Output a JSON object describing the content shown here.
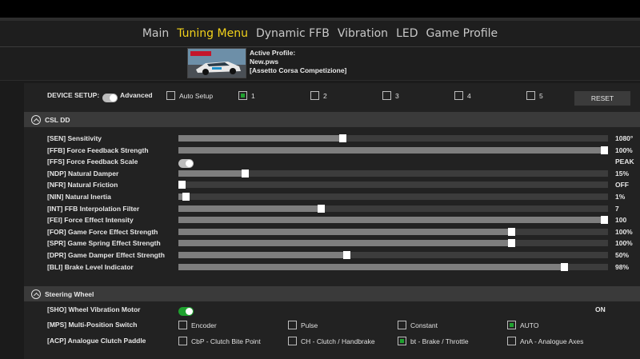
{
  "nav": {
    "tabs": [
      {
        "label": "Main",
        "active": false
      },
      {
        "label": "Tuning Menu",
        "active": true
      },
      {
        "label": "Dynamic FFB",
        "active": false
      },
      {
        "label": "Vibration",
        "active": false
      },
      {
        "label": "LED",
        "active": false
      },
      {
        "label": "Game Profile",
        "active": false
      }
    ]
  },
  "profile": {
    "line1": "Active Profile:",
    "line2": "New.pws",
    "line3": "[Assetto Corsa Competizione]",
    "thumbnail_icon": "race-car-thumbnail"
  },
  "device_setup": {
    "label": "DEVICE SETUP:",
    "advanced_label": "Advanced",
    "auto_setup_label": "Auto Setup",
    "slots": [
      {
        "label": "1",
        "checked": true
      },
      {
        "label": "2",
        "checked": false
      },
      {
        "label": "3",
        "checked": false
      },
      {
        "label": "4",
        "checked": false
      },
      {
        "label": "5",
        "checked": false
      }
    ],
    "reset_label": "RESET"
  },
  "csl_dd": {
    "title": "CSL DD",
    "params": [
      {
        "label": "[SEN] Sensitivity",
        "value": "1080°",
        "level": 0.38
      },
      {
        "label": "[FFB] Force Feedback Strength",
        "value": "100%",
        "level": 1.0
      },
      {
        "label": "[FFS] Force Feedback Scale",
        "value": "PEAK",
        "toggle": true
      },
      {
        "label": "[NDP] Natural Damper",
        "value": "15%",
        "level": 0.15
      },
      {
        "label": "[NFR] Natural Friction",
        "value": "OFF",
        "level": 0.0
      },
      {
        "label": "[NIN] Natural Inertia",
        "value": "1%",
        "level": 0.01
      },
      {
        "label": "[INT] FFB Interpolation Filter",
        "value": "7",
        "level": 0.33
      },
      {
        "label": "[FEI] Force Effect Intensity",
        "value": "100",
        "level": 1.0
      },
      {
        "label": "[FOR] Game Force Effect Strength",
        "value": "100%",
        "level": 0.78
      },
      {
        "label": "[SPR] Game Spring Effect Strength",
        "value": "100%",
        "level": 0.78
      },
      {
        "label": "[DPR] Game Damper Effect Strength",
        "value": "50%",
        "level": 0.39
      },
      {
        "label": "[BLI] Brake Level Indicator",
        "value": "98%",
        "level": 0.905
      }
    ]
  },
  "steering_wheel": {
    "title": "Steering Wheel",
    "sho": {
      "label": "[SHO] Wheel Vibration Motor",
      "value": "ON"
    },
    "mps": {
      "label": "[MPS] Multi-Position Switch",
      "options": [
        {
          "label": "Encoder",
          "checked": false
        },
        {
          "label": "Pulse",
          "checked": false
        },
        {
          "label": "Constant",
          "checked": false
        },
        {
          "label": "AUTO",
          "checked": true
        }
      ]
    },
    "acp": {
      "label": "[ACP] Analogue Clutch Paddle",
      "options": [
        {
          "label": "CbP - Clutch Bite Point",
          "checked": false
        },
        {
          "label": "CH - Clutch / Handbrake",
          "checked": false
        },
        {
          "label": "bt - Brake / Throttle",
          "checked": true
        },
        {
          "label": "AnA - Analogue Axes",
          "checked": false
        }
      ]
    }
  },
  "colors": {
    "accent": "#f2d21b",
    "toggle_on": "#1fa12f",
    "check_on": "#1fa12f"
  }
}
